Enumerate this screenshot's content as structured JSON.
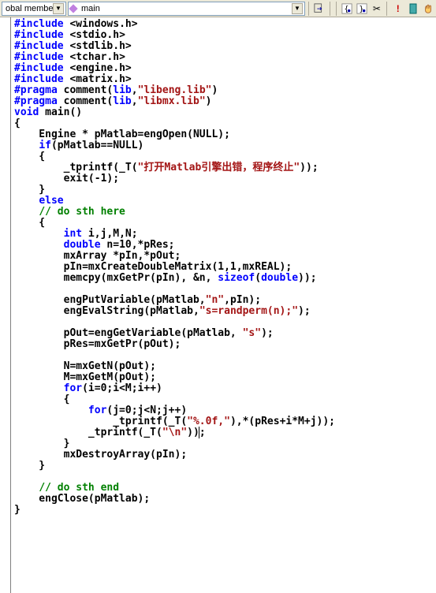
{
  "toolbar": {
    "combo1": "obal members",
    "combo2": "main",
    "icons": {
      "nav": "goto-icon",
      "aopen": "open-brace-icon",
      "aclose": "close-brace-icon",
      "cut": "cut-icon",
      "bang": "error-icon",
      "hash": "bookmark-icon",
      "hand": "hand-icon"
    }
  },
  "code": [
    {
      "t": [
        [
          "pp",
          "#include"
        ],
        [
          "nrm",
          " <windows.h>"
        ]
      ]
    },
    {
      "t": [
        [
          "pp",
          "#include"
        ],
        [
          "nrm",
          " <stdio.h>"
        ]
      ]
    },
    {
      "t": [
        [
          "pp",
          "#include"
        ],
        [
          "nrm",
          " <stdlib.h>"
        ]
      ]
    },
    {
      "t": [
        [
          "pp",
          "#include"
        ],
        [
          "nrm",
          " <tchar.h>"
        ]
      ]
    },
    {
      "t": [
        [
          "pp",
          "#include"
        ],
        [
          "nrm",
          " <engine.h>"
        ]
      ]
    },
    {
      "t": [
        [
          "pp",
          "#include"
        ],
        [
          "nrm",
          " <matrix.h>"
        ]
      ]
    },
    {
      "t": [
        [
          "pp",
          "#pragma"
        ],
        [
          "nrm",
          " comment("
        ],
        [
          "kw",
          "lib"
        ],
        [
          "nrm",
          ","
        ],
        [
          "str",
          "\"libeng.lib\""
        ],
        [
          "nrm",
          ")"
        ]
      ]
    },
    {
      "t": [
        [
          "pp",
          "#pragma"
        ],
        [
          "nrm",
          " comment("
        ],
        [
          "kw",
          "lib"
        ],
        [
          "nrm",
          ","
        ],
        [
          "str",
          "\"libmx.lib\""
        ],
        [
          "nrm",
          ")"
        ]
      ]
    },
    {
      "t": [
        [
          "kw",
          "void"
        ],
        [
          "nrm",
          " main()"
        ]
      ]
    },
    {
      "t": [
        [
          "nrm",
          "{"
        ]
      ]
    },
    {
      "t": [
        [
          "nrm",
          "    Engine * pMatlab=engOpen(NULL);"
        ]
      ]
    },
    {
      "t": [
        [
          "nrm",
          "    "
        ],
        [
          "kw",
          "if"
        ],
        [
          "nrm",
          "(pMatlab==NULL)"
        ]
      ]
    },
    {
      "t": [
        [
          "nrm",
          "    {"
        ]
      ]
    },
    {
      "t": [
        [
          "nrm",
          "        _tprintf(_T("
        ],
        [
          "str",
          "\"打开Matlab引擎出错，程序终止\""
        ],
        [
          "nrm",
          "));"
        ]
      ]
    },
    {
      "t": [
        [
          "nrm",
          "        exit(-1);"
        ]
      ]
    },
    {
      "t": [
        [
          "nrm",
          "    }"
        ]
      ]
    },
    {
      "t": [
        [
          "nrm",
          "    "
        ],
        [
          "kw",
          "else"
        ]
      ]
    },
    {
      "t": [
        [
          "nrm",
          "    "
        ],
        [
          "cm",
          "// do sth here"
        ]
      ]
    },
    {
      "t": [
        [
          "nrm",
          "    {"
        ]
      ]
    },
    {
      "t": [
        [
          "nrm",
          "        "
        ],
        [
          "kw",
          "int"
        ],
        [
          "nrm",
          " i,j,M,N;"
        ]
      ]
    },
    {
      "t": [
        [
          "nrm",
          "        "
        ],
        [
          "kw",
          "double"
        ],
        [
          "nrm",
          " n=10,*pRes;"
        ]
      ]
    },
    {
      "t": [
        [
          "nrm",
          "        mxArray *pIn,*pOut;"
        ]
      ]
    },
    {
      "t": [
        [
          "nrm",
          "        pIn=mxCreateDoubleMatrix(1,1,mxREAL);"
        ]
      ]
    },
    {
      "t": [
        [
          "nrm",
          "        memcpy(mxGetPr(pIn), &n, "
        ],
        [
          "kw",
          "sizeof"
        ],
        [
          "nrm",
          "("
        ],
        [
          "kw",
          "double"
        ],
        [
          "nrm",
          "));"
        ]
      ]
    },
    {
      "t": [
        [
          "nrm",
          ""
        ]
      ]
    },
    {
      "t": [
        [
          "nrm",
          "        engPutVariable(pMatlab,"
        ],
        [
          "str",
          "\"n\""
        ],
        [
          "nrm",
          ",pIn);"
        ]
      ]
    },
    {
      "t": [
        [
          "nrm",
          "        engEvalString(pMatlab,"
        ],
        [
          "str",
          "\"s=randperm(n);\""
        ],
        [
          "nrm",
          ");"
        ]
      ]
    },
    {
      "t": [
        [
          "nrm",
          ""
        ]
      ]
    },
    {
      "t": [
        [
          "nrm",
          "        pOut=engGetVariable(pMatlab, "
        ],
        [
          "str",
          "\"s\""
        ],
        [
          "nrm",
          ");"
        ]
      ]
    },
    {
      "t": [
        [
          "nrm",
          "        pRes=mxGetPr(pOut);"
        ]
      ]
    },
    {
      "t": [
        [
          "nrm",
          ""
        ]
      ]
    },
    {
      "t": [
        [
          "nrm",
          "        N=mxGetN(pOut);"
        ]
      ]
    },
    {
      "t": [
        [
          "nrm",
          "        M=mxGetM(pOut);"
        ]
      ]
    },
    {
      "t": [
        [
          "nrm",
          "        "
        ],
        [
          "kw",
          "for"
        ],
        [
          "nrm",
          "(i=0;i<M;i++)"
        ]
      ]
    },
    {
      "t": [
        [
          "nrm",
          "        {"
        ]
      ]
    },
    {
      "t": [
        [
          "nrm",
          "            "
        ],
        [
          "kw",
          "for"
        ],
        [
          "nrm",
          "(j=0;j<N;j++)"
        ]
      ]
    },
    {
      "t": [
        [
          "nrm",
          "                _tprintf(_T("
        ],
        [
          "str",
          "\"%.0f,\""
        ],
        [
          "nrm",
          "),*(pRes+i*M+j));"
        ]
      ]
    },
    {
      "t": [
        [
          "nrm",
          "            _tprintf(_T("
        ],
        [
          "str",
          "\"\\n\""
        ],
        [
          "nrm",
          "))"
        ],
        [
          "cursor",
          "|"
        ],
        [
          "nrm",
          ";"
        ]
      ]
    },
    {
      "t": [
        [
          "nrm",
          "        }"
        ]
      ]
    },
    {
      "t": [
        [
          "nrm",
          "        mxDestroyArray(pIn);"
        ]
      ]
    },
    {
      "t": [
        [
          "nrm",
          "    }"
        ]
      ]
    },
    {
      "t": [
        [
          "nrm",
          ""
        ]
      ]
    },
    {
      "t": [
        [
          "nrm",
          "    "
        ],
        [
          "cm",
          "// do sth end"
        ]
      ]
    },
    {
      "t": [
        [
          "nrm",
          "    engClose(pMatlab);"
        ]
      ]
    },
    {
      "t": [
        [
          "nrm",
          "}"
        ]
      ]
    }
  ]
}
